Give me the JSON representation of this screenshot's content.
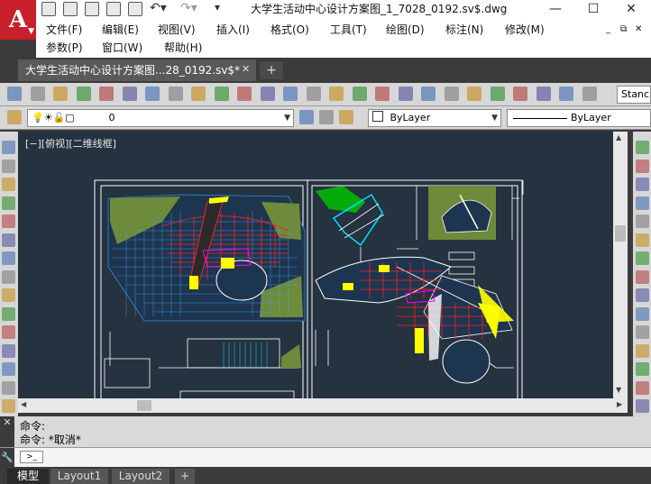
{
  "window": {
    "title": "大学生活动中心设计方案图_1_7028_0192.sv$.dwg",
    "minimize": "—",
    "maximize": "☐",
    "close": "✕"
  },
  "app": {
    "logo_letter": "A",
    "logo_caret": "▼"
  },
  "menu": {
    "row1": [
      "文件(F)",
      "编辑(E)",
      "视图(V)",
      "插入(I)",
      "格式(O)",
      "工具(T)",
      "绘图(D)",
      "标注(N)",
      "修改(M)"
    ],
    "row2": [
      "参数(P)",
      "窗口(W)",
      "帮助(H)"
    ],
    "mdi_controls": [
      "_",
      "⧉",
      "✕"
    ]
  },
  "doc_tab": {
    "label": "大学生活动中心设计方案图...28_0192.sv$*",
    "close": "✕",
    "add": "+"
  },
  "toolbar": {
    "text_style": "Stanc",
    "layer": "0",
    "color": "ByLayer",
    "linetype": "ByLayer"
  },
  "view": {
    "label": "[−][俯视][二维线框]"
  },
  "command": {
    "history": [
      "命令:",
      "命令: *取消*"
    ],
    "prompt_icon": ">_",
    "value": ""
  },
  "layout_tabs": [
    "模型",
    "Layout1",
    "Layout2"
  ],
  "layout_add": "+",
  "icons": {
    "toolbar1": [
      "new-icon",
      "open-icon",
      "save-icon",
      "plot-icon",
      "preview-icon",
      "publish-icon",
      "3dprint-icon",
      "cut-icon",
      "copy-icon",
      "paste-icon",
      "match-icon",
      "brush-icon",
      "undo-icon",
      "redo-icon",
      "pan-icon",
      "zoom-icon",
      "zoom-window-icon",
      "zoom-prev-icon",
      "properties-icon",
      "designcenter-icon",
      "toolpalette-icon",
      "sheetset-icon",
      "markup-icon",
      "calculator-icon",
      "help-icon",
      "textstyle-icon"
    ],
    "toolbar2": [
      "layer-manager-icon",
      "bulb-icon",
      "sun-icon",
      "lock-icon",
      "color-square-icon",
      "layer-state-icon",
      "make-current-icon",
      "layer-previous-icon"
    ],
    "left": [
      "line-icon",
      "construction-line-icon",
      "polyline-icon",
      "polygon-icon",
      "rectangle-icon",
      "arc-icon",
      "circle-icon",
      "revision-cloud-icon",
      "spline-icon",
      "ellipse-icon",
      "ellipse-arc-icon",
      "insert-block-icon",
      "make-block-icon",
      "point-icon",
      "hatch-icon"
    ],
    "right": [
      "erase-icon",
      "copy-object-icon",
      "mirror-icon",
      "offset-icon",
      "array-icon",
      "move-icon",
      "rotate-icon",
      "scale-icon",
      "stretch-icon",
      "trim-icon",
      "extend-icon",
      "break-icon",
      "join-icon",
      "chamfer-icon",
      "fillet-icon"
    ]
  },
  "colors": {
    "canvas": "#253240",
    "title_red": "#c8202a"
  }
}
